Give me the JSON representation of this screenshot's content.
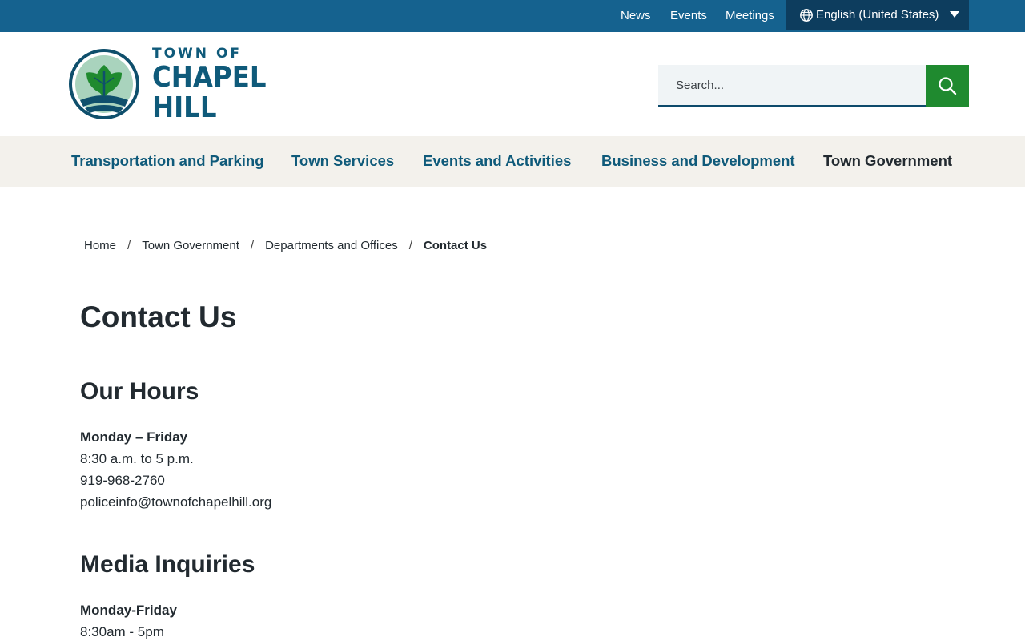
{
  "utility_nav": {
    "news": "News",
    "events": "Events",
    "meetings": "Meetings",
    "language": "English (United States)"
  },
  "logo": {
    "line1": "TOWN OF",
    "line2": "CHAPEL",
    "line3": "HILL"
  },
  "search": {
    "placeholder": "Search..."
  },
  "main_nav": {
    "items": [
      {
        "label": "Transportation and Parking"
      },
      {
        "label": "Town Services"
      },
      {
        "label": "Events and Activities"
      },
      {
        "label": "Business and Development"
      },
      {
        "label": "Town Government"
      }
    ]
  },
  "breadcrumb": {
    "items": [
      "Home",
      "Town Government",
      "Departments and Offices"
    ],
    "current": "Contact Us",
    "separator": "/"
  },
  "page": {
    "title": "Contact Us",
    "sections": [
      {
        "title": "Our Hours",
        "days": "Monday – Friday",
        "hours": "8:30 a.m. to 5 p.m.",
        "phone": "919-968-2760",
        "email": "policeinfo@townofchapelhill.org"
      },
      {
        "title": "Media Inquiries",
        "days": "Monday-Friday",
        "hours": "8:30am - 5pm"
      }
    ]
  },
  "colors": {
    "topbar": "#15628f",
    "language_bg": "#0d3d5e",
    "brand": "#0f5a7a",
    "search_button": "#1f8a2f",
    "nav_bg": "#f3f1ec"
  },
  "icons": {
    "globe": "globe-icon",
    "caret": "caret-down-icon",
    "search": "search-icon",
    "logo": "tulip-tree-leaf-logo"
  }
}
